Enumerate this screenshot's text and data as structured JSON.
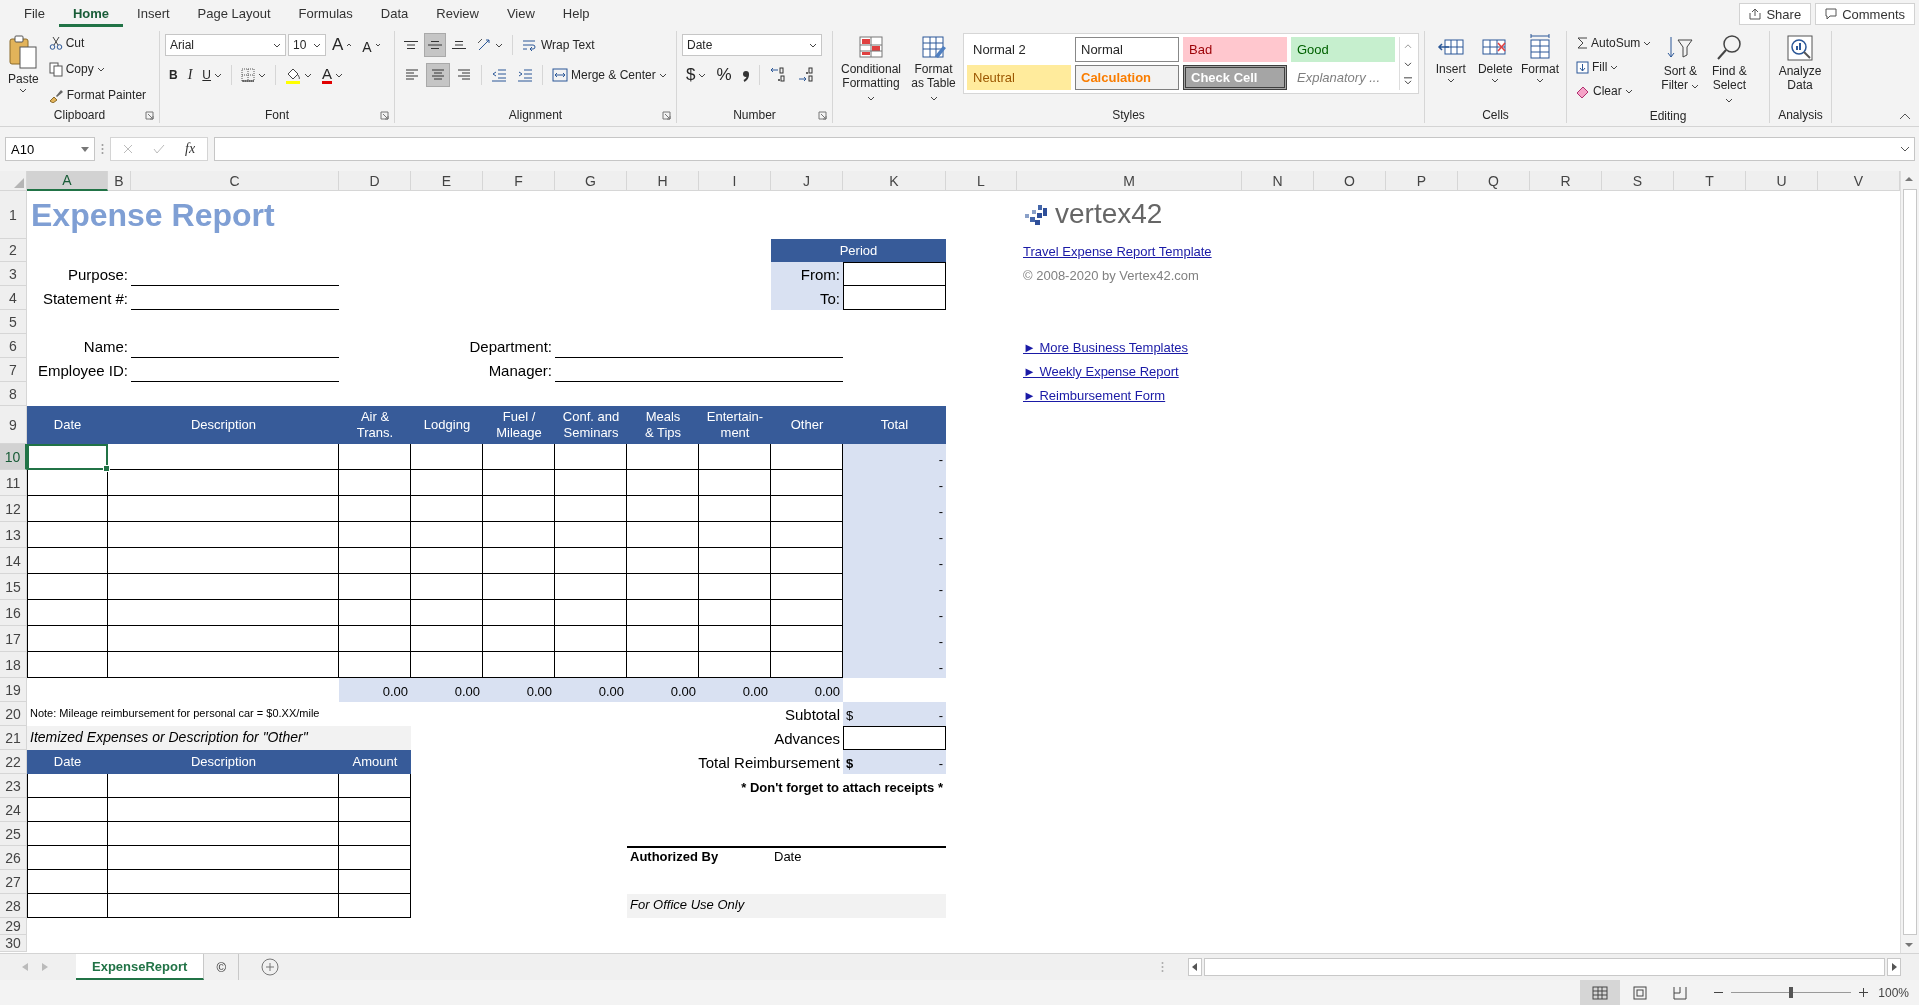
{
  "ribbon_tabs": [
    {
      "label": "File",
      "selected": false
    },
    {
      "label": "Home",
      "selected": true
    },
    {
      "label": "Insert",
      "selected": false
    },
    {
      "label": "Page Layout",
      "selected": false
    },
    {
      "label": "Formulas",
      "selected": false
    },
    {
      "label": "Data",
      "selected": false
    },
    {
      "label": "Review",
      "selected": false
    },
    {
      "label": "View",
      "selected": false
    },
    {
      "label": "Help",
      "selected": false
    }
  ],
  "share": "Share",
  "comments": "Comments",
  "ribbon": {
    "clipboard": {
      "label": "Clipboard",
      "paste": "Paste",
      "cut": "Cut",
      "copy": "Copy",
      "format_painter": "Format Painter"
    },
    "font": {
      "label": "Font",
      "font_name": "Arial",
      "font_size": "10",
      "grow_font": "A",
      "shrink_font": "A",
      "bold": "B",
      "italic": "I",
      "underline": "U",
      "font_color": "A"
    },
    "alignment": {
      "label": "Alignment",
      "wrap_text": "Wrap Text",
      "merge_center": "Merge & Center",
      "vertical_align": [
        {
          "kind": "top",
          "selected": false
        },
        {
          "kind": "middle",
          "selected": true
        },
        {
          "kind": "bottom",
          "selected": false
        }
      ],
      "horizontal_align": [
        {
          "kind": "left",
          "selected": false
        },
        {
          "kind": "center",
          "selected": true
        },
        {
          "kind": "right",
          "selected": false
        }
      ]
    },
    "number": {
      "label": "Number",
      "format": "Date",
      "currency": "$",
      "percent": "%"
    },
    "styles": {
      "label": "Styles",
      "conditional_formatting": "Conditional Formatting",
      "format_as_table": "Format as Table",
      "gallery": [
        {
          "label": "Normal 2",
          "kind": "plain"
        },
        {
          "label": "Normal",
          "kind": "normal"
        },
        {
          "label": "Bad",
          "kind": "bad"
        },
        {
          "label": "Good",
          "kind": "good"
        },
        {
          "label": "Neutral",
          "kind": "neutral"
        },
        {
          "label": "Calculation",
          "kind": "calculation"
        },
        {
          "label": "Check Cell",
          "kind": "check"
        },
        {
          "label": "Explanatory ...",
          "kind": "explanatory"
        }
      ]
    },
    "cells": {
      "label": "Cells",
      "insert": "Insert",
      "delete": "Delete",
      "format": "Format"
    },
    "editing": {
      "label": "Editing",
      "autosum": "AutoSum",
      "fill": "Fill",
      "clear": "Clear",
      "sort_filter": "Sort & Filter",
      "find_select": "Find & Select"
    },
    "analysis": {
      "label": "Analysis",
      "analyze_data": "Analyze Data"
    }
  },
  "formula_bar": {
    "name_box": "A10",
    "function_label": "fx"
  },
  "sheet": {
    "columns": [
      {
        "label": "A",
        "selected": true
      },
      {
        "label": "B",
        "selected": false
      },
      {
        "label": "C",
        "selected": false
      },
      {
        "label": "D",
        "selected": false
      },
      {
        "label": "E",
        "selected": false
      },
      {
        "label": "F",
        "selected": false
      },
      {
        "label": "G",
        "selected": false
      },
      {
        "label": "H",
        "selected": false
      },
      {
        "label": "I",
        "selected": false
      },
      {
        "label": "J",
        "selected": false
      },
      {
        "label": "K",
        "selected": false
      },
      {
        "label": "L",
        "selected": false
      },
      {
        "label": "M",
        "selected": false
      },
      {
        "label": "N",
        "selected": false
      },
      {
        "label": "O",
        "selected": false
      },
      {
        "label": "P",
        "selected": false
      },
      {
        "label": "Q",
        "selected": false
      },
      {
        "label": "R",
        "selected": false
      },
      {
        "label": "S",
        "selected": false
      },
      {
        "label": "T",
        "selected": false
      },
      {
        "label": "U",
        "selected": false
      },
      {
        "label": "V",
        "selected": false
      }
    ],
    "rows": [
      {
        "label": "1",
        "selected": false
      },
      {
        "label": "2",
        "selected": false
      },
      {
        "label": "3",
        "selected": false
      },
      {
        "label": "4",
        "selected": false
      },
      {
        "label": "5",
        "selected": false
      },
      {
        "label": "6",
        "selected": false
      },
      {
        "label": "7",
        "selected": false
      },
      {
        "label": "8",
        "selected": false
      },
      {
        "label": "9",
        "selected": false
      },
      {
        "label": "10",
        "selected": true
      },
      {
        "label": "11",
        "selected": false
      },
      {
        "label": "12",
        "selected": false
      },
      {
        "label": "13",
        "selected": false
      },
      {
        "label": "14",
        "selected": false
      },
      {
        "label": "15",
        "selected": false
      },
      {
        "label": "16",
        "selected": false
      },
      {
        "label": "17",
        "selected": false
      },
      {
        "label": "18",
        "selected": false
      },
      {
        "label": "19",
        "selected": false
      },
      {
        "label": "20",
        "selected": false
      },
      {
        "label": "21",
        "selected": false
      },
      {
        "label": "22",
        "selected": false
      },
      {
        "label": "23",
        "selected": false
      },
      {
        "label": "24",
        "selected": false
      },
      {
        "label": "25",
        "selected": false
      },
      {
        "label": "26",
        "selected": false
      },
      {
        "label": "27",
        "selected": false
      },
      {
        "label": "28",
        "selected": false
      },
      {
        "label": "29",
        "selected": false
      },
      {
        "label": "30",
        "selected": false
      }
    ],
    "title": "Expense Report",
    "period": {
      "heading": "Period",
      "from_label": "From:",
      "to_label": "To:"
    },
    "fields": [
      {
        "label": "Purpose:"
      },
      {
        "label": "Statement #:"
      },
      {
        "label": "Name:"
      },
      {
        "label": "Employee ID:"
      },
      {
        "label": "Department:"
      },
      {
        "label": "Manager:"
      }
    ],
    "expense_table": {
      "columns": [
        "Date",
        "Description",
        "Air &\nTrans.",
        "Lodging",
        "Fuel /\nMileage",
        "Conf. and\nSeminars",
        "Meals\n& Tips",
        "Entertain-\nment",
        "Other",
        "Total"
      ],
      "row_totals": [
        "-",
        "-",
        "-",
        "-",
        "-",
        "-",
        "-",
        "-",
        "-"
      ],
      "column_totals": [
        "0.00",
        "0.00",
        "0.00",
        "0.00",
        "0.00",
        "0.00",
        "0.00"
      ]
    },
    "note": "Note: Mileage reimbursement for personal car = $0.XX/mile",
    "itemized": {
      "title": "Itemized Expenses or Description for \"Other\"",
      "columns": [
        "Date",
        "Description",
        "Amount"
      ]
    },
    "summary": [
      {
        "label": "Subtotal",
        "kind": "total",
        "currency": "$",
        "value": "-"
      },
      {
        "label": "Advances",
        "kind": "input"
      },
      {
        "label": "Total Reimbursement",
        "kind": "grand_total",
        "currency": "$",
        "value": "-"
      }
    ],
    "reminder": "* Don't forget to attach receipts *",
    "signature": {
      "authorized_by": "Authorized By",
      "date": "Date",
      "office_use": "For Office Use Only"
    },
    "side": {
      "logo": "vertex42",
      "template_link": "Travel Expense Report Template",
      "copyright": "© 2008-2020 by Vertex42.com",
      "links": [
        "► More Business Templates",
        "► Weekly Expense Report",
        "► Reimbursement Form"
      ]
    }
  },
  "sheet_tabs": [
    {
      "label": "ExpenseReport",
      "selected": true
    },
    {
      "label": "©",
      "selected": false
    }
  ],
  "status_bar": {
    "views": [
      {
        "kind": "normal",
        "selected": true
      },
      {
        "kind": "page_layout",
        "selected": false
      },
      {
        "kind": "page_break",
        "selected": false
      }
    ],
    "zoom_slider": {
      "level": 0.5
    },
    "zoom": "100%"
  }
}
